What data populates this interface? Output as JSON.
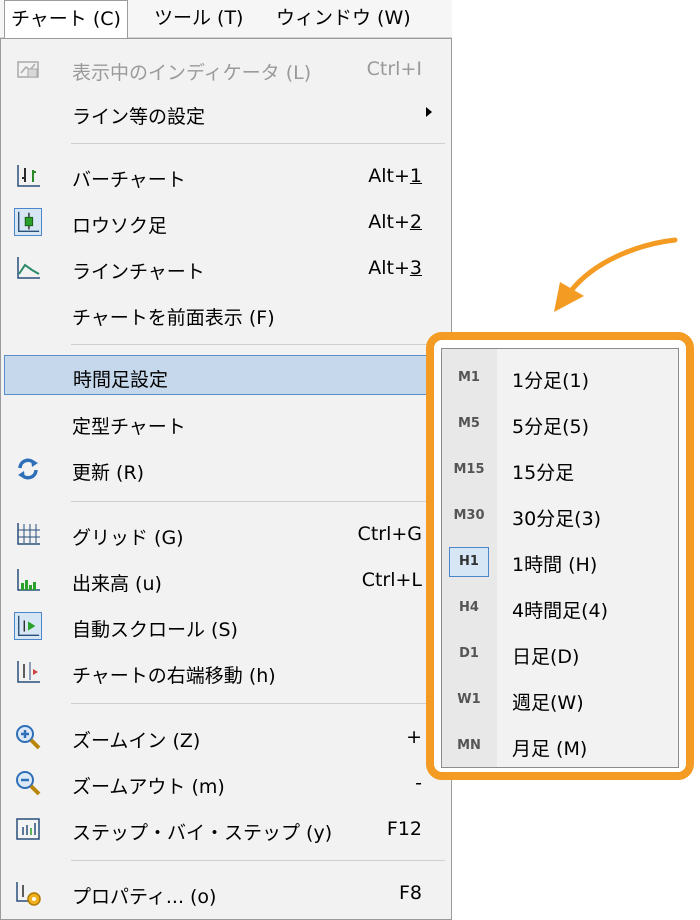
{
  "menubar": [
    {
      "label": "チャート (C)",
      "active": true
    },
    {
      "label": "ツール (T)",
      "active": false
    },
    {
      "label": "ウィンドウ (W)",
      "active": false
    }
  ],
  "menu": {
    "indicators": {
      "label": "表示中のインディケータ (L)",
      "shortcut": "Ctrl+I"
    },
    "line_settings": {
      "label": "ライン等の設定"
    },
    "bar_chart": {
      "label": "バーチャート",
      "shortcut_prefix": "Alt+",
      "shortcut_key": "1"
    },
    "candlestick": {
      "label": "ロウソク足",
      "shortcut_prefix": "Alt+",
      "shortcut_key": "2"
    },
    "line_chart": {
      "label": "ラインチャート",
      "shortcut_prefix": "Alt+",
      "shortcut_key": "3"
    },
    "foreground": {
      "label": "チャートを前面表示 (F)"
    },
    "timeframe": {
      "label": "時間足設定"
    },
    "templates": {
      "label": "定型チャート"
    },
    "refresh": {
      "label": "更新 (R)"
    },
    "grid": {
      "label": "グリッド (G)",
      "shortcut": "Ctrl+G"
    },
    "volume": {
      "label": "出来高 (u)",
      "shortcut": "Ctrl+L"
    },
    "autoscroll": {
      "label": "自動スクロール (S)"
    },
    "chart_shift": {
      "label": "チャートの右端移動 (h)"
    },
    "zoom_in": {
      "label": "ズームイン (Z)",
      "shortcut": "+"
    },
    "zoom_out": {
      "label": "ズームアウト (m)",
      "shortcut": "-"
    },
    "step": {
      "label": "ステップ・バイ・ステップ (y)",
      "shortcut": "F12"
    },
    "properties": {
      "label": "プロパティ... (o)",
      "shortcut": "F8"
    }
  },
  "submenu": [
    {
      "code": "M1",
      "label": "1分足(1)"
    },
    {
      "code": "M5",
      "label": "5分足(5)"
    },
    {
      "code": "M15",
      "label": "15分足"
    },
    {
      "code": "M30",
      "label": "30分足(3)"
    },
    {
      "code": "H1",
      "label": "1時間 (H)",
      "active": true
    },
    {
      "code": "H4",
      "label": "4時間足(4)"
    },
    {
      "code": "D1",
      "label": "日足(D)"
    },
    {
      "code": "W1",
      "label": "週足(W)"
    },
    {
      "code": "MN",
      "label": "月足 (M)"
    }
  ],
  "colors": {
    "highlight": "#f39b22",
    "accent": "#4a86c8"
  }
}
